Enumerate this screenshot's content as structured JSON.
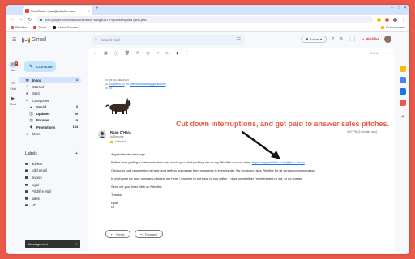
{
  "browser": {
    "tab_title": "CorpTech - ryan@pitchfire.com",
    "new_tab": "+",
    "url": "mail.google.com/mail/u/1/#inbox/FMfcgzGzTrFfgSMkrxcjNwdTjsfxLjNw",
    "bookmarks": [
      "Pitchfire",
      "Gmail",
      "Adobe Express"
    ],
    "bookmarks_right": "All Bookmarks"
  },
  "gmail": {
    "logo_text": "Gmail",
    "search_placeholder": "Search mail",
    "status": "Active",
    "brand": "Pitchfire"
  },
  "rail": {
    "mail_label": "Mail",
    "mail_badge": "4",
    "chat_label": "Chat",
    "meet_label": "Meet"
  },
  "nav": {
    "compose": "Compose",
    "items": [
      {
        "label": "Inbox",
        "count": "4"
      },
      {
        "label": "Starred",
        "count": ""
      },
      {
        "label": "Sent",
        "count": ""
      },
      {
        "label": "Categories",
        "count": ""
      }
    ],
    "categories": [
      {
        "label": "Social",
        "count": "3"
      },
      {
        "label": "Updates",
        "count": "99"
      },
      {
        "label": "Forums",
        "count": "15"
      },
      {
        "label": "Promotions",
        "count": "154"
      }
    ],
    "more": "More",
    "labels_title": "Labels",
    "labels_add": "+",
    "labels": [
      "advisor",
      "cold email",
      "invoice",
      "legal",
      "Pitchfire Mail",
      "sales",
      "VC"
    ]
  },
  "toast": {
    "text": "Message sent",
    "close": "✕"
  },
  "toolbar": {
    "pager": "1 of 4"
  },
  "signature": {
    "phone": "(970) 346-5707",
    "site": "corptech.co",
    "email": "daxnewsletters@gmail.com"
  },
  "reply": {
    "sender": "Ryan O'Hara",
    "to": "to Denon ▾",
    "tag": "Unknown",
    "date": "4:57 PM (2 minutes ago)",
    "greeting": "Appreciate the message.",
    "p1": "Rather than getting no response from me, would you mind pitching me on my Pitchfire account here:",
    "p1_link": "https://app.pitchfire.com/@ryan-ohara",
    "p2": "Obviously cold prospecting is hard, and getting responses from prospects is even harder. My company uses Pitchfire for all vendor communication.",
    "p3": "In exchange for your company pitching me here, I promise to get back to you within 7 days on whether I'm interested or not, or no charge.",
    "p4": "Send me your best pitch on Pitchfire.",
    "signoff": "Thanks,",
    "name": "Ryan",
    "ellipsis": "•••",
    "reply_btn": "Reply",
    "forward_btn": "Forward"
  },
  "overlay": {
    "caption": "Cut down interruptions, and get paid to answer sales pitches."
  },
  "colors": {
    "background": "#e8594a",
    "accent": "#c2e7ff",
    "caption": "#e8594a"
  }
}
